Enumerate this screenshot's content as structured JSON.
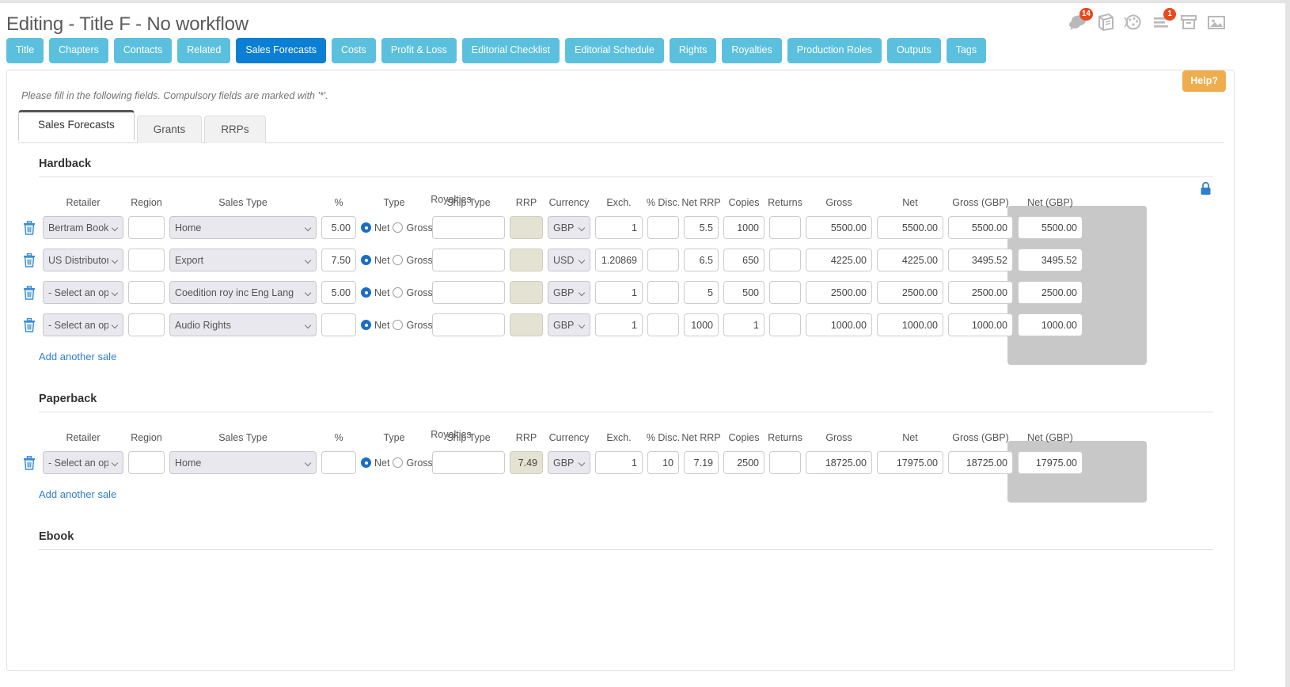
{
  "header": {
    "title": "Editing - Title F - No workflow",
    "icons": [
      {
        "name": "comments-icon",
        "badge": "14"
      },
      {
        "name": "book-icon",
        "badge": ""
      },
      {
        "name": "dashboard-icon",
        "badge": ""
      },
      {
        "name": "tasks-icon",
        "badge": "1"
      },
      {
        "name": "archive-icon",
        "badge": ""
      },
      {
        "name": "image-icon",
        "badge": ""
      }
    ]
  },
  "tabs": [
    {
      "label": "Title",
      "active": false
    },
    {
      "label": "Chapters",
      "active": false
    },
    {
      "label": "Contacts",
      "active": false
    },
    {
      "label": "Related",
      "active": false
    },
    {
      "label": "Sales Forecasts",
      "active": true
    },
    {
      "label": "Costs",
      "active": false
    },
    {
      "label": "Profit & Loss",
      "active": false
    },
    {
      "label": "Editorial Checklist",
      "active": false
    },
    {
      "label": "Editorial Schedule",
      "active": false
    },
    {
      "label": "Rights",
      "active": false
    },
    {
      "label": "Royalties",
      "active": false
    },
    {
      "label": "Production Roles",
      "active": false
    },
    {
      "label": "Outputs",
      "active": false
    },
    {
      "label": "Tags",
      "active": false
    }
  ],
  "help_label": "Help?",
  "instructions": "Please fill in the following fields. Compulsory fields are marked with '*'.",
  "subtabs": [
    {
      "label": "Sales Forecasts",
      "active": true
    },
    {
      "label": "Grants",
      "active": false
    },
    {
      "label": "RRPs",
      "active": false
    }
  ],
  "grid_headers": {
    "group_label": "Royalties",
    "retailer": "Retailer",
    "region": "Region",
    "sales_type": "Sales Type",
    "pct": "%",
    "type": "Type",
    "ship_type": "Ship Type",
    "rrp": "RRP",
    "currency": "Currency",
    "exch": "Exch.",
    "disc": "% Disc.",
    "net_rrp": "Net RRP",
    "copies": "Copies",
    "returns": "Returns",
    "gross": "Gross",
    "net": "Net",
    "gross_gbp": "Gross (GBP)",
    "net_gbp": "Net (GBP)"
  },
  "radio_labels": {
    "net": "Net",
    "gross": "Gross"
  },
  "add_link_label": "Add another sale",
  "sections": [
    {
      "title": "Hardback",
      "rows": [
        {
          "retailer": "Bertram Books",
          "region": "",
          "sales_type": "Home",
          "pct": "5.00",
          "royalty_type": "net",
          "ship_type": "",
          "rrp": "",
          "currency": "GBP",
          "exch": "1",
          "disc": "",
          "net_rrp": "5.5",
          "copies": "1000",
          "returns": "",
          "gross": "5500.00",
          "net": "5500.00",
          "gross_gbp": "5500.00",
          "net_gbp": "5500.00"
        },
        {
          "retailer": "US Distributor",
          "region": "",
          "sales_type": "Export",
          "pct": "7.50",
          "royalty_type": "net",
          "ship_type": "",
          "rrp": "",
          "currency": "USD",
          "exch": "1.20869",
          "disc": "",
          "net_rrp": "6.5",
          "copies": "650",
          "returns": "",
          "gross": "4225.00",
          "net": "4225.00",
          "gross_gbp": "3495.52",
          "net_gbp": "3495.52"
        },
        {
          "retailer": "- Select an option -",
          "region": "",
          "sales_type": "Coedition roy inc Eng Lang",
          "pct": "5.00",
          "royalty_type": "net",
          "ship_type": "",
          "rrp": "",
          "currency": "GBP",
          "exch": "1",
          "disc": "",
          "net_rrp": "5",
          "copies": "500",
          "returns": "",
          "gross": "2500.00",
          "net": "2500.00",
          "gross_gbp": "2500.00",
          "net_gbp": "2500.00"
        },
        {
          "retailer": "- Select an option -",
          "region": "",
          "sales_type": "Audio Rights",
          "pct": "",
          "royalty_type": "net",
          "ship_type": "",
          "rrp": "",
          "currency": "GBP",
          "exch": "1",
          "disc": "",
          "net_rrp": "1000",
          "copies": "1",
          "returns": "",
          "gross": "1000.00",
          "net": "1000.00",
          "gross_gbp": "1000.00",
          "net_gbp": "1000.00"
        }
      ]
    },
    {
      "title": "Paperback",
      "rows": [
        {
          "retailer": "- Select an option -",
          "region": "",
          "sales_type": "Home",
          "pct": "",
          "royalty_type": "net",
          "ship_type": "",
          "rrp": "7.49",
          "currency": "GBP",
          "exch": "1",
          "disc": "10",
          "net_rrp": "7.19",
          "copies": "2500",
          "returns": "",
          "gross": "18725.00",
          "net": "17975.00",
          "gross_gbp": "18725.00",
          "net_gbp": "17975.00"
        }
      ]
    },
    {
      "title": "Ebook",
      "rows": []
    }
  ],
  "colors": {
    "tab_inactive": "#5bc0de",
    "tab_active": "#0b7fd4",
    "help": "#f0ad4e",
    "badge": "#e8491d",
    "link": "#2f7fd0",
    "gbp_panel": "#c8c8c8",
    "rrp_beige": "#e4e2d2"
  }
}
